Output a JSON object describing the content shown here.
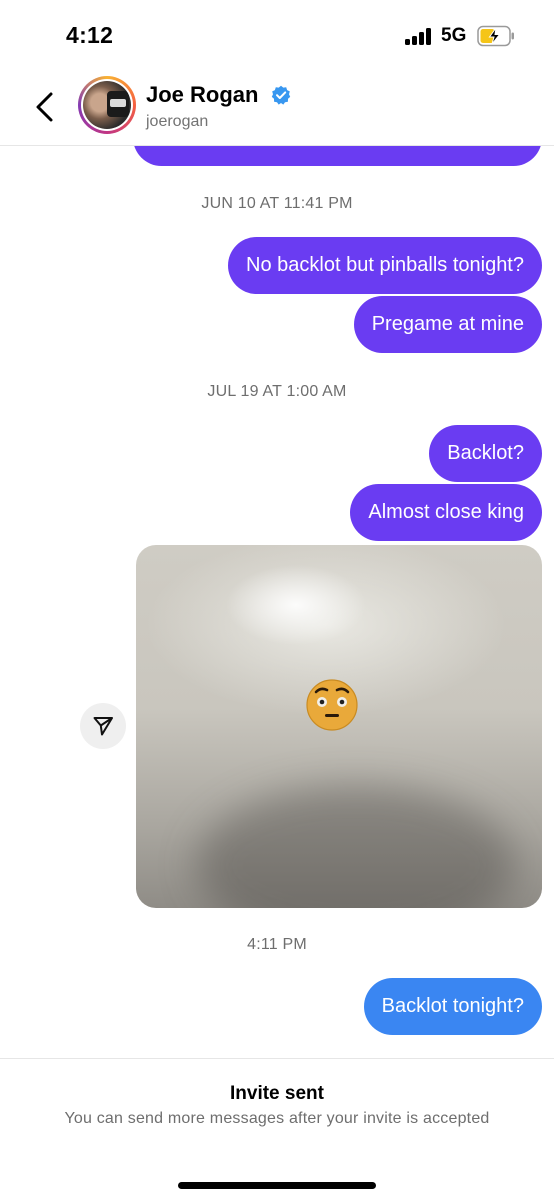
{
  "status_bar": {
    "time": "4:12",
    "network": "5G",
    "icons": [
      "signal-bars-icon",
      "battery-charging-icon"
    ],
    "battery_color": "#f5c518"
  },
  "header": {
    "contact_name": "Joe Rogan",
    "contact_handle": "joerogan",
    "icons": [
      "back-chevron-icon",
      "verified-badge-icon"
    ],
    "verified_color": "#3897f0"
  },
  "chat": {
    "colors": {
      "sent_purple": "#6a3cf2",
      "sent_blue": "#3a86f2"
    },
    "timestamps": [
      "JUN 10 AT 11:41 PM",
      "JUL 19 AT 1:00 AM",
      "4:11 PM"
    ],
    "messages": [
      {
        "text": "No backlot but pinballs tonight?",
        "from": "me"
      },
      {
        "text": "Pregame at mine",
        "from": "me"
      },
      {
        "text": "Backlot?",
        "from": "me"
      },
      {
        "text": "Almost close king",
        "from": "me"
      },
      {
        "text": "Backlot tonight?",
        "from": "me"
      }
    ],
    "photo_message": {
      "description_icon": "emoji-photo"
    },
    "share_icon": "send-icon"
  },
  "footer": {
    "invite_title": "Invite sent",
    "invite_subtitle": "You can send more messages after your invite is accepted"
  }
}
